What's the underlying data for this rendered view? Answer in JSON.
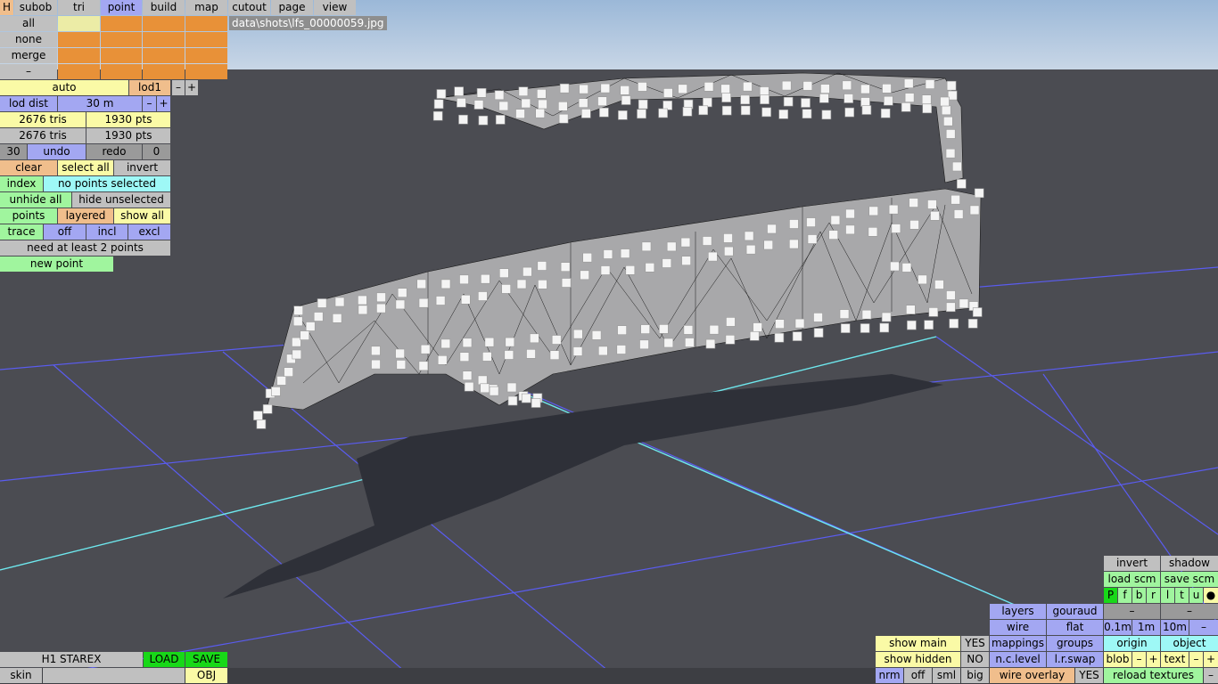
{
  "top_tabs": {
    "h": "H",
    "subob": "subob",
    "tri": "tri",
    "point": "point",
    "build": "build",
    "map": "map",
    "cutout": "cutout",
    "page": "page",
    "view": "view"
  },
  "file_path": "data\\shots\\lfs_00000059.jpg",
  "selection": {
    "all": "all",
    "none": "none",
    "merge": "merge",
    "dash": "–"
  },
  "lod": {
    "auto": "auto",
    "lod1": "lod1",
    "minus": "–",
    "plus": "+",
    "lod_dist_label": "lod dist",
    "lod_dist_value": "30 m"
  },
  "stats": {
    "tris1": "2676 tris",
    "pts1": "1930 pts",
    "tris2": "2676 tris",
    "pts2": "1930 pts"
  },
  "undo_row": {
    "count": "30",
    "undo": "undo",
    "redo": "redo",
    "redo_count": "0"
  },
  "sel_row": {
    "clear": "clear",
    "select_all": "select all",
    "invert": "invert"
  },
  "index_row": {
    "index": "index",
    "status": "no points selected"
  },
  "hide_row": {
    "unhide_all": "unhide all",
    "hide_unselected": "hide unselected"
  },
  "points_row": {
    "points": "points",
    "layered": "layered",
    "show_all": "show all"
  },
  "trace_row": {
    "trace": "trace",
    "off": "off",
    "incl": "incl",
    "excl": "excl"
  },
  "hint": "need at least 2 points",
  "new_point": "new point",
  "bottom_left": {
    "vehicle": "H1 STAREX",
    "load": "LOAD",
    "save": "SAVE",
    "skin": "skin",
    "obj": "OBJ"
  },
  "bottom_right": {
    "invert": "invert",
    "shadow": "shadow",
    "load_scm": "load scm",
    "save_scm": "save scm",
    "views": [
      "P",
      "f",
      "b",
      "r",
      "l",
      "t",
      "u",
      "●"
    ],
    "layers": "layers",
    "gouraud": "gouraud",
    "dash1": "–",
    "dash2": "–",
    "wire": "wire",
    "flat": "flat",
    "s01": "0.1m",
    "s1": "1m",
    "s10": "10m",
    "dash3": "–",
    "show_main": "show main",
    "show_main_val": "YES",
    "mappings": "mappings",
    "groups": "groups",
    "origin": "origin",
    "object": "object",
    "show_hidden": "show hidden",
    "show_hidden_val": "NO",
    "nclevel": "n.c.level",
    "lrswap": "l.r.swap",
    "blob": "blob",
    "text": "text",
    "minus": "–",
    "plus": "+",
    "nrm": "nrm",
    "off": "off",
    "sml": "sml",
    "big": "big",
    "wire_overlay": "wire overlay",
    "wire_overlay_val": "YES",
    "reload_textures": "reload textures"
  },
  "colors": {
    "sky": "#a9c3df",
    "floor": "#4b4c52",
    "grid": "#5a5cf0",
    "axis": "#6ee8ee",
    "shadow": "#2e3038",
    "mesh": "#a8a8aa",
    "points": "#f4f4f4"
  }
}
